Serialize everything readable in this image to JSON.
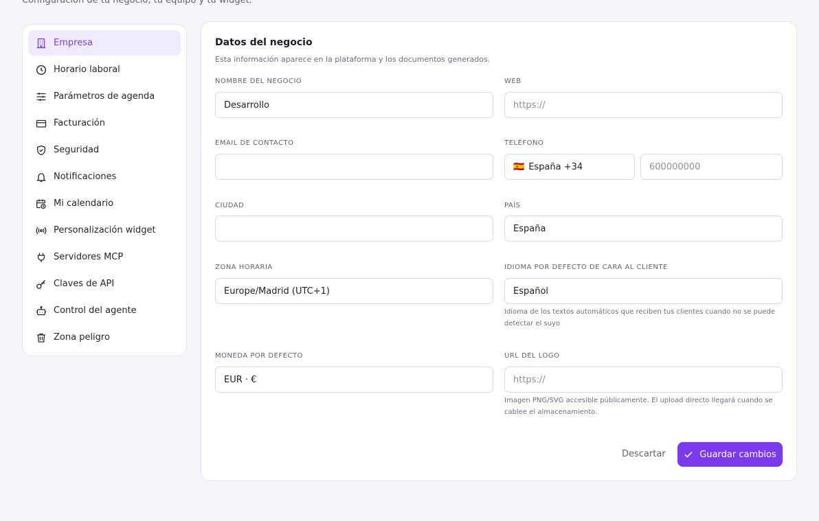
{
  "page": {
    "subtitle": "Configuración de tu negocio, tu equipo y tu widget."
  },
  "sidebar": {
    "items": [
      {
        "label": "Empresa",
        "icon": "building-icon",
        "active": true
      },
      {
        "label": "Horario laboral",
        "icon": "clock-icon"
      },
      {
        "label": "Parámetros de agenda",
        "icon": "sliders-icon"
      },
      {
        "label": "Facturación",
        "icon": "credit-card-icon"
      },
      {
        "label": "Seguridad",
        "icon": "shield-check-icon"
      },
      {
        "label": "Notificaciones",
        "icon": "bell-icon"
      },
      {
        "label": "Mi calendario",
        "icon": "calendar-clock-icon"
      },
      {
        "label": "Personalización widget",
        "icon": "broadcast-icon"
      },
      {
        "label": "Servidores MCP",
        "icon": "plug-icon"
      },
      {
        "label": "Claves de API",
        "icon": "key-icon"
      },
      {
        "label": "Control del agente",
        "icon": "bot-icon"
      },
      {
        "label": "Zona peligro",
        "icon": "trash-icon"
      }
    ]
  },
  "form": {
    "title": "Datos del negocio",
    "description": "Esta información aparece en la plataforma y los documentos generados.",
    "business_name": {
      "label": "NOMBRE DEL NEGOCIO",
      "value": "Desarrollo"
    },
    "web": {
      "label": "WEB",
      "placeholder": "https://"
    },
    "email": {
      "label": "EMAIL DE CONTACTO",
      "value": ""
    },
    "phone": {
      "label": "TELÉFONO",
      "country": "España +34",
      "placeholder": "600000000"
    },
    "city": {
      "label": "CIUDAD",
      "value": ""
    },
    "country": {
      "label": "PAÍS",
      "value": "España"
    },
    "timezone": {
      "label": "ZONA HORARIA",
      "value": "Europe/Madrid (UTC+1)"
    },
    "language": {
      "label": "IDIOMA POR DEFECTO DE CARA AL CLIENTE",
      "value": "Español",
      "help_line1": "Idioma de los textos automáticos que reciben tus clientes cuando no se puede",
      "help_line2": "detectar el suyo"
    },
    "currency": {
      "label": "MONEDA POR DEFECTO",
      "value": "EUR · €"
    },
    "logo_url": {
      "label": "URL DEL LOGO",
      "placeholder": "https://",
      "help_line1": "Imagen PNG/SVG accesible públicamente. El upload directo llegará cuando se",
      "help_line2": "cablee el almacenamiento."
    }
  },
  "actions": {
    "discard_label": "Descartar",
    "save_label": "Guardar cambios"
  },
  "colors": {
    "accent": "#7c3aed",
    "active_bg": "#f0ebfd",
    "active_text": "#7a3fe3"
  }
}
